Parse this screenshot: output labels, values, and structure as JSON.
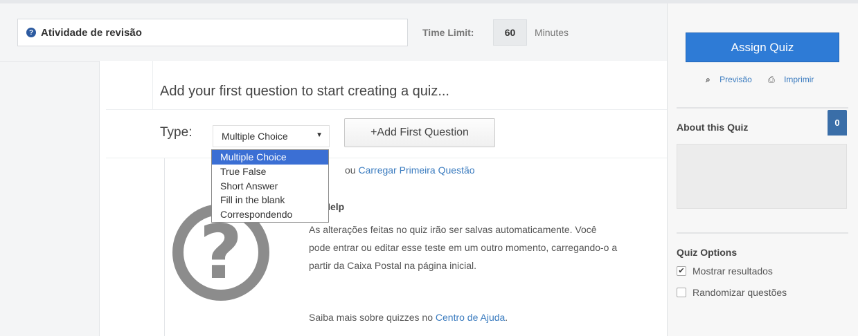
{
  "header": {
    "quiz_title": "Atividade de revisão",
    "time_limit_label": "Time Limit:",
    "time_limit_value": "60",
    "minutes_label": "Minutes"
  },
  "main": {
    "heading": "Add your first question to start creating a quiz...",
    "type_label": "Type:",
    "type_selected": "Multiple Choice",
    "type_options": [
      "Multiple Choice",
      "True False",
      "Short Answer",
      "Fill in the blank",
      "Correspondendo"
    ],
    "add_first_question": "+Add First Question",
    "or_text": "ou",
    "upload_link": "Carregar Primeira Questão",
    "help_title": "z Help",
    "help_text": "As alterações feitas no quiz irão ser salvas automaticamente. Você pode entrar ou editar esse teste em um outro momento, carregando-o a partir da Caixa Postal na página inicial.",
    "help_more_prefix": "Saiba mais sobre quizzes no",
    "help_center_link": "Centro de Ajuda",
    "help_more_suffix": "."
  },
  "sidebar": {
    "assign_button": "Assign Quiz",
    "preview_label": "Previsão",
    "print_label": "Imprimir",
    "about_title": "About this Quiz",
    "about_badge": "0",
    "options_title": "Quiz Options",
    "option_show_results": {
      "label": "Mostrar resultados",
      "checked": true
    },
    "option_randomize": {
      "label": "Randomizar questões",
      "checked": false
    }
  },
  "colors": {
    "accent_button": "#2e7bd6",
    "link": "#3a7bbf",
    "dropdown_highlight": "#3b6fd4",
    "badge": "#3a6ea8"
  }
}
